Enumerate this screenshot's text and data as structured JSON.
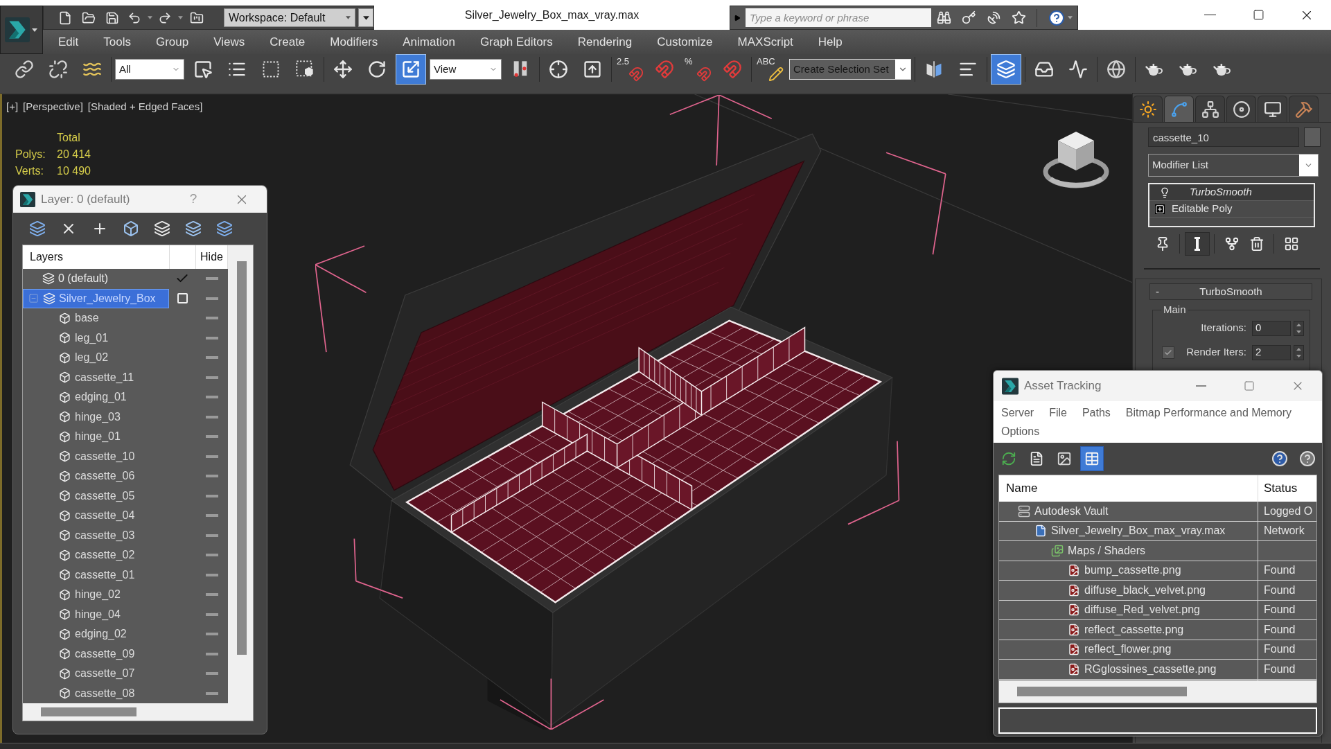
{
  "title_bar": {
    "workspace": "Workspace: Default",
    "title": "Silver_Jewelry_Box_max_vray.max",
    "search_placeholder": "Type a keyword or phrase"
  },
  "menu": [
    "Edit",
    "Tools",
    "Group",
    "Views",
    "Create",
    "Modifiers",
    "Animation",
    "Graph Editors",
    "Rendering",
    "Customize",
    "MAXScript",
    "Help"
  ],
  "main_toolbar": [
    {
      "kind": "button",
      "on": false
    },
    {
      "kind": "button",
      "on": false
    },
    {
      "kind": "button",
      "on": false
    },
    {
      "kind": "dropdown",
      "value": "All"
    },
    {
      "kind": "button",
      "on": false
    },
    {
      "kind": "button",
      "on": false
    },
    {
      "kind": "button",
      "on": false
    },
    {
      "kind": "button",
      "on": false
    },
    {
      "kind": "button",
      "on": false
    },
    {
      "kind": "button",
      "on": false
    },
    {
      "kind": "button",
      "on": true
    },
    {
      "kind": "dropdown",
      "value": "View"
    },
    {
      "kind": "button",
      "on": false
    },
    {
      "kind": "button",
      "on": false
    },
    {
      "kind": "button",
      "on": false
    },
    {
      "kind": "button",
      "on": false,
      "label": "2.5"
    },
    {
      "kind": "button",
      "on": false
    },
    {
      "kind": "button",
      "on": false,
      "label": "%"
    },
    {
      "kind": "button",
      "on": false
    },
    {
      "kind": "button",
      "on": false,
      "label": "ABC"
    },
    {
      "kind": "dropdown",
      "value": "Create Selection Set"
    },
    {
      "kind": "button",
      "on": false
    },
    {
      "kind": "button",
      "on": false
    },
    {
      "kind": "button",
      "on": true
    },
    {
      "kind": "button",
      "on": false
    },
    {
      "kind": "button",
      "on": false
    },
    {
      "kind": "button",
      "on": false
    },
    {
      "kind": "button",
      "on": false
    },
    {
      "kind": "button",
      "on": false
    },
    {
      "kind": "button",
      "on": false
    }
  ],
  "viewport": {
    "labels": [
      "[+]",
      "[Perspective]",
      "[Shaded + Edged Faces]"
    ],
    "stats_heading": "Total",
    "stats": [
      {
        "label": "Polys:",
        "value": "20 414"
      },
      {
        "label": "Verts:",
        "value": "10 490"
      }
    ]
  },
  "layer_window": {
    "title": "Layer: 0 (default)",
    "help": "?",
    "columns": [
      "Layers",
      "Hide"
    ],
    "layers": [
      {
        "name": "0 (default)",
        "current": true,
        "hidden": false,
        "selected": false
      },
      {
        "name": "Silver_Jewelry_Box",
        "current": false,
        "hidden": false,
        "selected": true,
        "expanded": true,
        "children": [
          {
            "name": "base",
            "hidden": false,
            "selected": false
          },
          {
            "name": "leg_01",
            "hidden": false,
            "selected": false
          },
          {
            "name": "leg_02",
            "hidden": false,
            "selected": false
          },
          {
            "name": "cassette_11",
            "hidden": false,
            "selected": false
          },
          {
            "name": "edging_01",
            "hidden": false,
            "selected": false
          },
          {
            "name": "hinge_03",
            "hidden": false,
            "selected": false
          },
          {
            "name": "hinge_01",
            "hidden": false,
            "selected": false
          },
          {
            "name": "cassette_10",
            "hidden": false,
            "selected": false
          },
          {
            "name": "cassette_06",
            "hidden": false,
            "selected": false
          },
          {
            "name": "cassette_05",
            "hidden": false,
            "selected": false
          },
          {
            "name": "cassette_04",
            "hidden": false,
            "selected": false
          },
          {
            "name": "cassette_03",
            "hidden": false,
            "selected": false
          },
          {
            "name": "cassette_02",
            "hidden": false,
            "selected": false
          },
          {
            "name": "cassette_01",
            "hidden": false,
            "selected": false
          },
          {
            "name": "hinge_02",
            "hidden": false,
            "selected": false
          },
          {
            "name": "hinge_04",
            "hidden": false,
            "selected": false
          },
          {
            "name": "edging_02",
            "hidden": false,
            "selected": false
          },
          {
            "name": "cassette_09",
            "hidden": false,
            "selected": false
          },
          {
            "name": "cassette_07",
            "hidden": false,
            "selected": false
          },
          {
            "name": "cassette_08",
            "hidden": false,
            "selected": false
          }
        ]
      }
    ]
  },
  "command_panel": {
    "tabs": [
      {
        "selected": false
      },
      {
        "selected": true
      },
      {
        "selected": false
      },
      {
        "selected": false
      },
      {
        "selected": false
      },
      {
        "selected": false
      }
    ],
    "object_name": "cassette_10",
    "modifier_list": "Modifier List",
    "stack": [
      {
        "kind": "modifier",
        "name": "TurboSmooth",
        "selected": true
      },
      {
        "kind": "base",
        "name": "Editable Poly",
        "selected": false
      }
    ],
    "stack_buttons": [
      {
        "on": false
      },
      {
        "on": true
      },
      {
        "on": false
      },
      {
        "on": false
      },
      {
        "on": false
      }
    ],
    "rollout": {
      "toggle": "-",
      "title": "TurboSmooth",
      "group": "Main",
      "fields": [
        {
          "kind": "spinner",
          "label": "Iterations:",
          "value": "0"
        },
        {
          "kind": "checkbox_spinner",
          "label": "Render Iters:",
          "value": "2",
          "checked": true
        }
      ]
    }
  },
  "asset_window": {
    "title": "Asset Tracking",
    "menu": [
      "Server",
      "File",
      "Paths",
      "Bitmap Performance and Memory",
      "Options"
    ],
    "view_buttons": [
      {
        "selected": false
      },
      {
        "selected": false
      },
      {
        "selected": false
      },
      {
        "selected": true
      }
    ],
    "columns": [
      "Name",
      "Status"
    ],
    "assets": [
      {
        "kind": "vault",
        "name": "Autodesk Vault",
        "status": "Logged O",
        "children": [
          {
            "kind": "max",
            "name": "Silver_Jewelry_Box_max_vray.max",
            "status": "Network",
            "children": [
              {
                "kind": "maps",
                "name": "Maps / Shaders",
                "children": [
                  {
                    "kind": "png",
                    "name": "bump_cassette.png",
                    "status": "Found"
                  },
                  {
                    "kind": "png",
                    "name": "diffuse_black_velvet.png",
                    "status": "Found"
                  },
                  {
                    "kind": "png",
                    "name": "diffuse_Red_velvet.png",
                    "status": "Found"
                  },
                  {
                    "kind": "png",
                    "name": "reflect_cassette.png",
                    "status": "Found"
                  },
                  {
                    "kind": "png",
                    "name": "reflect_flower.png",
                    "status": "Found"
                  },
                  {
                    "kind": "png",
                    "name": "RGglossines_cassette.png",
                    "status": "Found"
                  }
                ]
              }
            ]
          }
        ]
      }
    ]
  }
}
